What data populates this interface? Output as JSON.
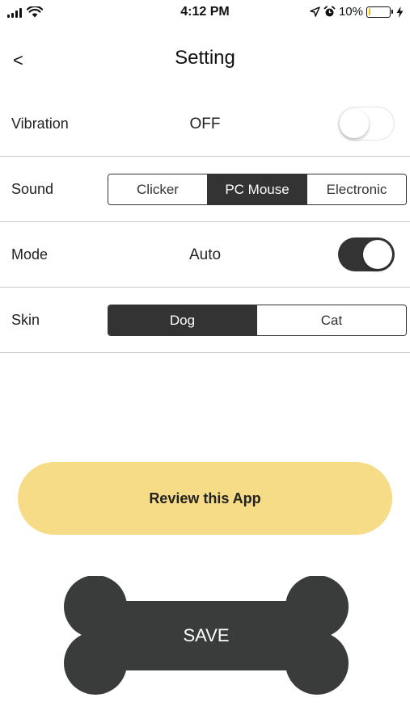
{
  "status_bar": {
    "time": "4:12 PM",
    "battery_percent": "10%",
    "battery_level": 0.1
  },
  "nav": {
    "back_label": "<",
    "title": "Setting"
  },
  "settings": {
    "vibration": {
      "label": "Vibration",
      "value": "OFF",
      "toggle_on": false
    },
    "sound": {
      "label": "Sound",
      "options": [
        "Clicker",
        "PC Mouse",
        "Electronic"
      ],
      "selected": "PC Mouse"
    },
    "mode": {
      "label": "Mode",
      "value": "Auto",
      "toggle_on": true
    },
    "skin": {
      "label": "Skin",
      "options": [
        "Dog",
        "Cat"
      ],
      "selected": "Dog"
    }
  },
  "review_button": {
    "label": "Review this App"
  },
  "save_button": {
    "label": "SAVE"
  },
  "colors": {
    "accent_dark": "#333333",
    "review_yellow": "#f6dc86",
    "battery_yellow": "#f2c200",
    "divider": "#c8c8c8"
  }
}
